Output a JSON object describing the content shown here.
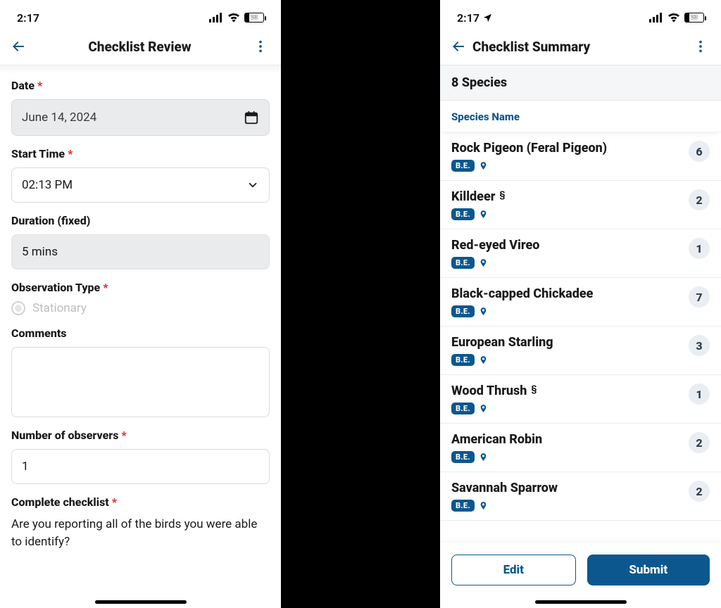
{
  "statusbar": {
    "time": "2:17",
    "battery": "23",
    "location_on": true
  },
  "left": {
    "title": "Checklist Review",
    "date_label": "Date",
    "date_value": "June 14, 2024",
    "start_label": "Start Time",
    "start_value": "02:13 PM",
    "duration_label": "Duration (fixed)",
    "duration_value": "5 mins",
    "obs_label": "Observation Type",
    "obs_value": "Stationary",
    "comments_label": "Comments",
    "comments_value": "",
    "observers_label": "Number of observers",
    "observers_value": "1",
    "complete_label": "Complete checklist",
    "complete_caption": "Are you reporting all of the birds you were able to identify?"
  },
  "right": {
    "title": "Checklist Summary",
    "count_header": "8 Species",
    "column_header": "Species Name",
    "edit_label": "Edit",
    "submit_label": "Submit",
    "species": [
      {
        "name": "Rock Pigeon (Feral Pigeon)",
        "count": 6,
        "be": "B.E.",
        "sup": ""
      },
      {
        "name": "Killdeer",
        "count": 2,
        "be": "B.E.",
        "sup": "§"
      },
      {
        "name": "Red-eyed Vireo",
        "count": 1,
        "be": "B.E.",
        "sup": ""
      },
      {
        "name": "Black-capped Chickadee",
        "count": 7,
        "be": "B.E.",
        "sup": ""
      },
      {
        "name": "European Starling",
        "count": 3,
        "be": "B.E.",
        "sup": ""
      },
      {
        "name": "Wood Thrush",
        "count": 1,
        "be": "B.E.",
        "sup": "§"
      },
      {
        "name": "American Robin",
        "count": 2,
        "be": "B.E.",
        "sup": ""
      },
      {
        "name": "Savannah Sparrow",
        "count": 2,
        "be": "B.E.",
        "sup": ""
      }
    ]
  }
}
